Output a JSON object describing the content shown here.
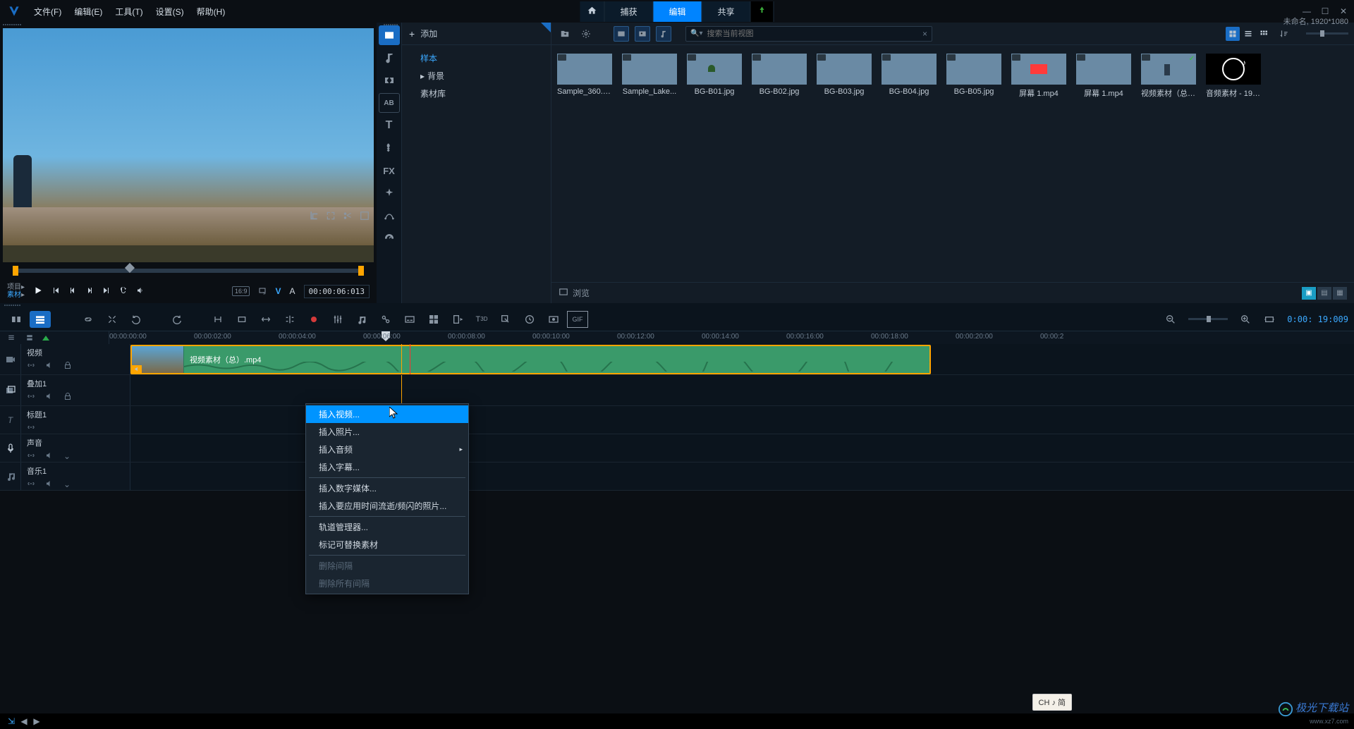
{
  "menu": {
    "file": "文件(F)",
    "edit": "编辑(E)",
    "tool": "工具(T)",
    "setting": "设置(S)",
    "help": "帮助(H)"
  },
  "tabs": {
    "capture": "捕获",
    "editTab": "编辑",
    "share": "共享"
  },
  "titleInfo": "未命名, 1920*1080",
  "preview": {
    "projLabel1": "项目",
    "projLabel2": "素材",
    "aspect": "16:9",
    "v": "V",
    "a": "A",
    "timecode": "00:00:06:013"
  },
  "libtree": {
    "add": "添加",
    "items": [
      "样本",
      "背景",
      "素材库"
    ]
  },
  "search": {
    "placeholder": "搜索当前视图"
  },
  "assets": [
    {
      "name": "Sample_360.m...",
      "cls": "t-360",
      "hasCheck": false
    },
    {
      "name": "Sample_Lake...",
      "cls": "t-lake",
      "hasCheck": false
    },
    {
      "name": "BG-B01.jpg",
      "cls": "t-b01",
      "hasCheck": false
    },
    {
      "name": "BG-B02.jpg",
      "cls": "t-b02",
      "hasCheck": false
    },
    {
      "name": "BG-B03.jpg",
      "cls": "t-b03",
      "hasCheck": false
    },
    {
      "name": "BG-B04.jpg",
      "cls": "t-b04",
      "hasCheck": false
    },
    {
      "name": "BG-B05.jpg",
      "cls": "t-b05",
      "hasCheck": false
    },
    {
      "name": "屏幕 1.mp4",
      "cls": "t-scr1",
      "hasCheck": false
    },
    {
      "name": "屏幕 1.mp4",
      "cls": "t-scr2",
      "hasCheck": false
    },
    {
      "name": "视频素材（总）...",
      "cls": "t-vid",
      "hasCheck": true
    },
    {
      "name": "音频素材 - 196...",
      "cls": "audio",
      "hasCheck": false
    }
  ],
  "browse": "浏览",
  "timecodes": [
    "00:00:00:00",
    "00:00:02:00",
    "00:00:04:00",
    "00:00:06:00",
    "00:00:08:00",
    "00:00:10:00",
    "00:00:12:00",
    "00:00:14:00",
    "00:00:16:00",
    "00:00:18:00",
    "00:00:20:00",
    "00:00:2"
  ],
  "tlTimecode": "0:00: 19:009",
  "tracks": {
    "video": "视频",
    "overlay": "叠加1",
    "title": "标题1",
    "voice": "声音",
    "music": "音乐1"
  },
  "clip": {
    "label": "视频素材（总）.mp4"
  },
  "ctx": {
    "insertVideo": "插入视频...",
    "insertPhoto": "插入照片...",
    "insertAudio": "插入音频",
    "insertSubtitle": "插入字幕...",
    "insertDigital": "插入数字媒体...",
    "insertTimelapse": "插入要应用时间流逝/频闪的照片...",
    "trackMgr": "轨道管理器...",
    "markReplace": "标记可替换素材",
    "delGap": "删除间隔",
    "delAllGap": "删除所有间隔"
  },
  "ime": "CH ♪ 简",
  "watermark": {
    "name": "极光下载站",
    "url": "www.xz7.com"
  }
}
